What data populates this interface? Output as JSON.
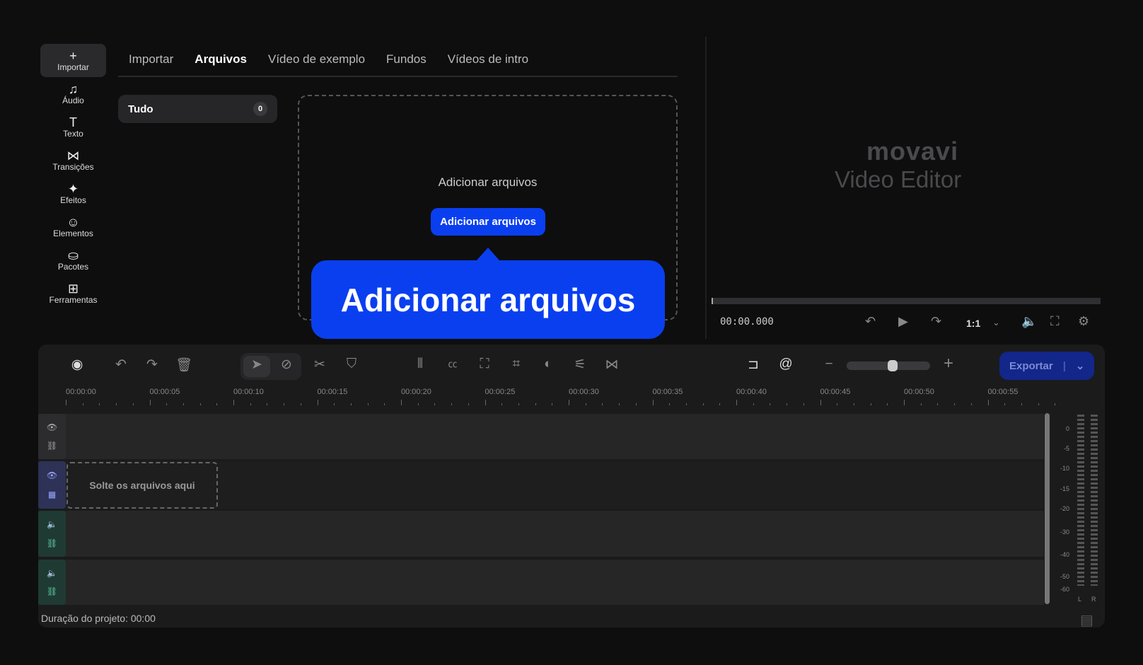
{
  "sidebar": {
    "items": [
      {
        "icon": "plus-icon",
        "glyph": "+",
        "label": "Importar",
        "active": true
      },
      {
        "icon": "music-note-icon",
        "glyph": "♫",
        "label": "Áudio"
      },
      {
        "icon": "text-icon",
        "glyph": "T",
        "label": "Texto"
      },
      {
        "icon": "transition-icon",
        "glyph": "⋈",
        "label": "Transições"
      },
      {
        "icon": "sparkle-icon",
        "glyph": "✦",
        "label": "Efeitos"
      },
      {
        "icon": "smiley-icon",
        "glyph": "☺",
        "label": "Elementos"
      },
      {
        "icon": "bag-plus-icon",
        "glyph": "⛀",
        "label": "Pacotes"
      },
      {
        "icon": "grid-plus-icon",
        "glyph": "⊞",
        "label": "Ferramentas"
      }
    ]
  },
  "tabs": [
    {
      "label": "Importar"
    },
    {
      "label": "Arquivos",
      "active": true
    },
    {
      "label": "Vídeo de exemplo"
    },
    {
      "label": "Fundos"
    },
    {
      "label": "Vídeos de intro"
    }
  ],
  "filter": {
    "label": "Tudo",
    "count": "0"
  },
  "dropzone": {
    "text": "Adicionar arquivos",
    "button": "Adicionar arquivos"
  },
  "tooltip": {
    "text": "Adicionar arquivos"
  },
  "preview": {
    "logo_brand": "movavi",
    "logo_product": "Video Editor",
    "timecode": "00:00.000",
    "ratio": "1:1",
    "progress": 0
  },
  "toolbar": {
    "zoom_level": 0.55,
    "export_label": "Exportar"
  },
  "ruler": [
    "00:00:00",
    "00:00:05",
    "00:00:10",
    "00:00:15",
    "00:00:20",
    "00:00:25",
    "00:00:30",
    "00:00:35",
    "00:00:40",
    "00:00:45",
    "00:00:50",
    "00:00:55"
  ],
  "timeline": {
    "drop_text": "Solte os arquivos aqui"
  },
  "meter": {
    "labels": [
      "0",
      "-5",
      "-10",
      "-15",
      "-20",
      "-30",
      "-40",
      "-50",
      "-60"
    ],
    "left": "L",
    "right": "R"
  },
  "footer": {
    "duration": "Duração do projeto: 00:00"
  },
  "colors": {
    "accent": "#0a3ff0",
    "export": "#13268a",
    "video_track": "#2d3256",
    "audio_track": "#1f3a33"
  }
}
